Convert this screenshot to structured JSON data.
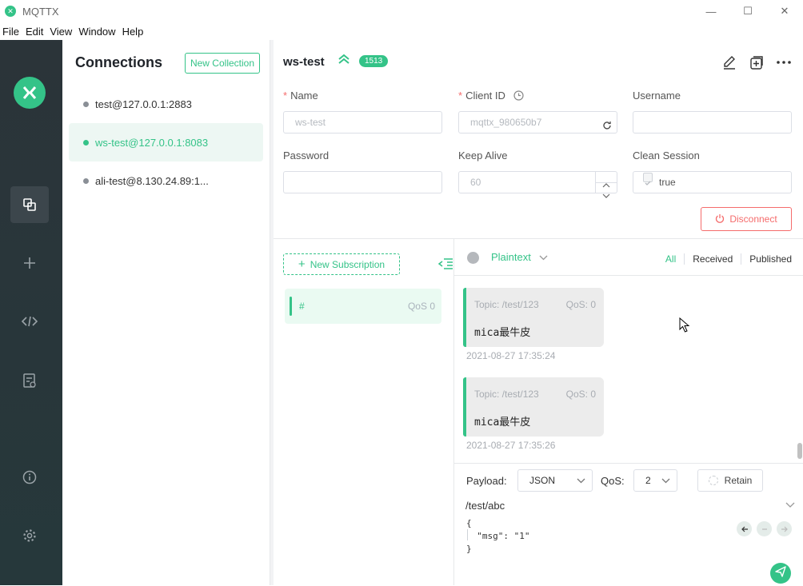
{
  "window": {
    "title": "MQTTX"
  },
  "menu": [
    "File",
    "Edit",
    "View",
    "Window",
    "Help"
  ],
  "connections_panel": {
    "title": "Connections",
    "new_collection_label": "New Collection",
    "items": [
      {
        "label": "test@127.0.0.1:2883",
        "status": "offline"
      },
      {
        "label": "ws-test@127.0.0.1:8083",
        "status": "online",
        "active": true
      },
      {
        "label": "ali-test@8.130.24.89:1...",
        "status": "offline"
      }
    ]
  },
  "connection_header": {
    "name": "ws-test",
    "badge": "1513"
  },
  "form": {
    "name_label": "Name",
    "name_value": "ws-test",
    "client_id_label": "Client ID",
    "client_id_value": "mqttx_980650b7",
    "username_label": "Username",
    "username_value": "",
    "password_label": "Password",
    "password_value": "",
    "keep_alive_label": "Keep Alive",
    "keep_alive_value": "60",
    "clean_session_label": "Clean Session",
    "clean_session_value": "true",
    "disconnect_label": "Disconnect"
  },
  "subscriptions": {
    "new_subscription_label": "New Subscription",
    "items": [
      {
        "topic": "#",
        "qos": "QoS 0"
      }
    ]
  },
  "messages": {
    "format": "Plaintext",
    "filters": [
      "All",
      "Received",
      "Published"
    ],
    "active_filter": "All",
    "items": [
      {
        "topic": "Topic: /test/123",
        "qos": "QoS: 0",
        "payload": "mica最牛皮",
        "time": "2021-08-27 17:35:24"
      },
      {
        "topic": "Topic: /test/123",
        "qos": "QoS: 0",
        "payload": "mica最牛皮",
        "time": "2021-08-27 17:35:26"
      }
    ]
  },
  "publish": {
    "payload_label": "Payload:",
    "payload_format": "JSON",
    "qos_label": "QoS:",
    "qos_value": "2",
    "retain_label": "Retain",
    "topic": "/test/abc",
    "editor_lines": [
      "{",
      "  \"msg\": \"1\"",
      "}"
    ]
  },
  "colors": {
    "accent": "#34c388",
    "danger": "#f56c6c",
    "sidebar": "#2b3439"
  }
}
